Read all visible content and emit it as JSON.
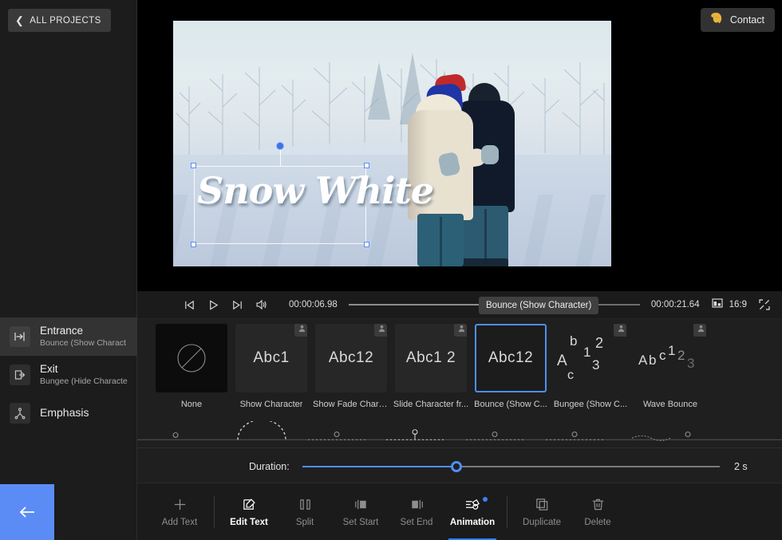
{
  "header": {
    "all_projects_label": "ALL PROJECTS",
    "contact_label": "Contact",
    "contact_icon": "contact-avatar-icon",
    "back_chevron_icon": "chevron-left-icon"
  },
  "preview": {
    "text_overlay": "Snow White",
    "scene_description": "winter forest couple embracing in snow",
    "rotation_handle_icon": "rotate-handle-dot",
    "selection_handles": 4
  },
  "playbar": {
    "prev_frame_icon": "skip-previous-icon",
    "play_icon": "play-icon",
    "next_frame_icon": "skip-next-icon",
    "volume_icon": "volume-icon",
    "current_time": "00:00:06.98",
    "total_time": "00:00:21.64",
    "progress_percent": 54,
    "ratio_icon": "aspect-ratio-icon",
    "ratio_label": "16:9",
    "fullscreen_icon": "fullscreen-icon",
    "tooltip": "Bounce (Show Character)"
  },
  "sidebar": {
    "items": [
      {
        "label": "Entrance",
        "sub": "Bounce (Show Charact",
        "icon": "entrance-arrow-in-icon",
        "selected": true
      },
      {
        "label": "Exit",
        "sub": "Bungee (Hide Characte",
        "icon": "exit-arrow-out-icon",
        "selected": false
      },
      {
        "label": "Emphasis",
        "sub": "",
        "icon": "emphasis-icon",
        "selected": false
      }
    ]
  },
  "animations": {
    "items": [
      {
        "label": "None",
        "preview": "none",
        "vip": false,
        "selected": false
      },
      {
        "label": "Show Character",
        "preview": "Abc1",
        "vip": true,
        "selected": false
      },
      {
        "label": "Show Fade Chara...",
        "preview": "Abc12",
        "vip": true,
        "selected": false
      },
      {
        "label": "Slide Character fr...",
        "preview": "Abc1 2",
        "vip": true,
        "selected": false
      },
      {
        "label": "Bounce (Show C...",
        "preview": "Abc12",
        "vip": false,
        "selected": true
      },
      {
        "label": "Bungee (Show C...",
        "preview": "scatter",
        "vip": true,
        "selected": false
      },
      {
        "label": "Wave Bounce",
        "preview": "AbcC12 3",
        "vip": true,
        "selected": false
      }
    ]
  },
  "duration": {
    "label": "Duration:",
    "value": "2 s",
    "percent": 37
  },
  "toolbar": {
    "items": [
      {
        "label": "Add Text",
        "icon": "plus-icon",
        "state": "dim",
        "badge": false
      },
      {
        "label": "Edit Text",
        "icon": "edit-pencil-icon",
        "state": "bright",
        "badge": false
      },
      {
        "label": "Split",
        "icon": "split-icon",
        "state": "dim",
        "badge": false
      },
      {
        "label": "Set Start",
        "icon": "set-start-icon",
        "state": "dim",
        "badge": false
      },
      {
        "label": "Set End",
        "icon": "set-end-icon",
        "state": "dim",
        "badge": false
      },
      {
        "label": "Animation",
        "icon": "animation-icon",
        "state": "active",
        "badge": true
      },
      {
        "label": "Duplicate",
        "icon": "duplicate-icon",
        "state": "dim",
        "badge": false
      },
      {
        "label": "Delete",
        "icon": "trash-icon",
        "state": "dim",
        "badge": false
      }
    ]
  },
  "back_button": {
    "icon": "arrow-left-icon"
  },
  "colors": {
    "accent_blue": "#4f8ef7",
    "back_button_blue": "#5b8cf5",
    "contact_gold": "#e8b23c",
    "panel_bg": "#1f1f1f",
    "app_bg": "#1b1b1b"
  }
}
